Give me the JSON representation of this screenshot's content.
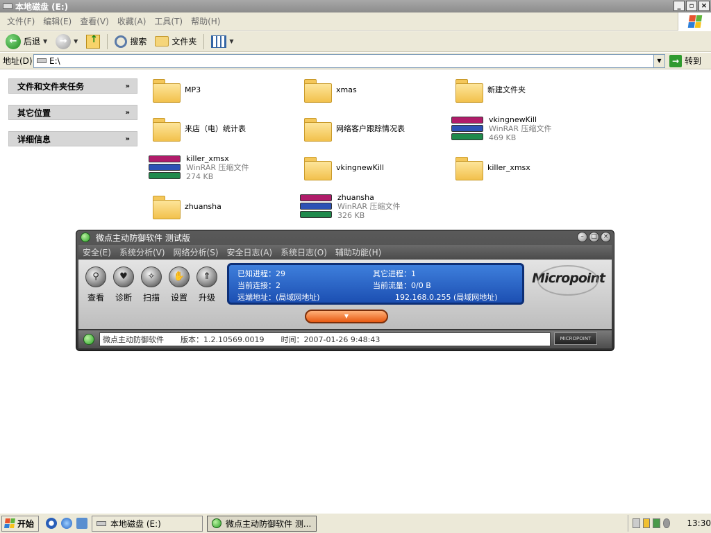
{
  "window": {
    "title": "本地磁盘 (E:)"
  },
  "menu": [
    "文件(F)",
    "编辑(E)",
    "查看(V)",
    "收藏(A)",
    "工具(T)",
    "帮助(H)"
  ],
  "toolbar": {
    "back": "后退",
    "search": "搜索",
    "folders": "文件夹"
  },
  "address": {
    "label": "地址(D)",
    "value": "E:\\",
    "go": "转到"
  },
  "task_pane": [
    "文件和文件夹任务",
    "其它位置",
    "详细信息"
  ],
  "files": [
    {
      "name": "MP3",
      "type": "folder"
    },
    {
      "name": "xmas",
      "type": "folder"
    },
    {
      "name": "新建文件夹",
      "type": "folder"
    },
    {
      "name": "来店（电）统计表",
      "type": "folder"
    },
    {
      "name": "网络客户跟踪情况表",
      "type": "folder"
    },
    {
      "name": "vkingnewKill",
      "type": "rar",
      "desc": "WinRAR 压缩文件",
      "size": "469 KB"
    },
    {
      "name": "killer_xmsx",
      "type": "rar",
      "desc": "WinRAR 压缩文件",
      "size": "274 KB"
    },
    {
      "name": "vkingnewKill",
      "type": "folder"
    },
    {
      "name": "killer_xmsx",
      "type": "folder"
    },
    {
      "name": "zhuansha",
      "type": "folder"
    },
    {
      "name": "zhuansha",
      "type": "rar",
      "desc": "WinRAR 压缩文件",
      "size": "326 KB"
    }
  ],
  "mp": {
    "title": "微点主动防御软件  测试版",
    "menu": [
      "安全(E)",
      "系统分析(V)",
      "网络分析(S)",
      "安全日志(A)",
      "系统日志(O)",
      "辅助功能(H)"
    ],
    "tools": [
      "查看",
      "诊断",
      "扫描",
      "设置",
      "升级"
    ],
    "known_proc": "已知进程：29",
    "other_proc": "其它进程：1",
    "conn": "当前连接：2",
    "traffic": "当前流量：0/0 B",
    "remote": "远端地址：(局域网地址)",
    "ip": "192.168.0.255 (局域网地址)",
    "logo": "Micropoint",
    "status_name": "微点主动防御软件",
    "status_version": "版本：1.2.10569.0019",
    "status_time": "时间：2007-01-26 9:48:43",
    "status_logo": "MICROPOINT"
  },
  "taskbar": {
    "start": "开始",
    "items": [
      "本地磁盘 (E:)",
      "微点主动防御软件  测..."
    ],
    "clock": "13:30"
  }
}
